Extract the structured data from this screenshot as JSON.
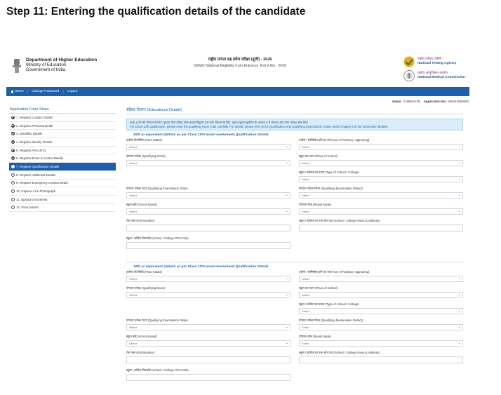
{
  "step_heading": "Step 11: Entering the qualification details of the candidate",
  "header": {
    "dept_line1": "Department of Higher Education",
    "dept_line2": "Ministry of Education",
    "dept_line3": "Government of India",
    "exam_title_hi": "राष्ट्रीय पात्रता सह प्रवेश परीक्षा (यूजी) - 2026",
    "exam_title_en": "DEMO National Eligibility Cum Entrance Test (UG) - 2026",
    "nta_hi": "राष्ट्रीय परीक्षा एजेंसी",
    "nta_en": "National Testing Agency",
    "nmc_hi": "राष्ट्रीय आयुर्विज्ञान आयोग",
    "nmc_en": "National Medical Commission"
  },
  "nav": {
    "home": "Home",
    "change_password": "Change Password",
    "logout": "Logout"
  },
  "info": {
    "name_label": "Name:",
    "name_value": "CANDIDATE",
    "app_label": "Application No.:",
    "app_value": "260410000060"
  },
  "sidebar": {
    "title": "Application Form Steps",
    "items": [
      {
        "label": "1. Register Contact Details",
        "state": "done"
      },
      {
        "label": "2. Register Personal Detail",
        "state": "done"
      },
      {
        "label": "3. Disability Details",
        "state": "done"
      },
      {
        "label": "4. Register Identity Details",
        "state": "done"
      },
      {
        "label": "5. Register APAAR ID",
        "state": "done"
      },
      {
        "label": "6. Register Exam & Center Details",
        "state": "done"
      },
      {
        "label": "7. Register Qualification Details",
        "state": "active"
      },
      {
        "label": "8. Register Additional Details",
        "state": "open"
      },
      {
        "label": "9. Register Emergency Contact Detail",
        "state": "open"
      },
      {
        "label": "10. Capture Live Photograph",
        "state": "open"
      },
      {
        "label": "11. Upload Documents",
        "state": "open"
      },
      {
        "label": "12. Final Submit",
        "state": "open"
      }
    ]
  },
  "main": {
    "title": "शैक्षिक विवरण (Educational Details)",
    "notice_line1": "कक्षा 12वीं की योग्यता के लिए, कृपया योग्य परीक्षा कोड सावधानीपूर्वक दर्ज करें। विवरण के लिए, कृपया सूचना बुलेटिन के अध्याय 6 में योग्यता और योग्य परीक्षा कोड देखें।",
    "notice_line2": "For Class 12th qualification, please enter the qualifying exam code carefully. For details, please refer to the Qualification and Qualifying Examination Codes under Chapter 6 of the Information Bulletin.",
    "select_placeholder": "Select",
    "sections": [
      {
        "heading": "10th or equivalent (details as per Class 10th board marksheet) Qualification Details",
        "pass_status": "उत्तीर्ण की स्थिति (Pass Status)",
        "year_passing": "उत्तीर्ण / सम्मिलित होने का वर्ष (Year of Passing / Appearing)",
        "qualifying_exam": "योग्यता परीक्षा (Qualifying Exam)",
        "place_school": "स्कूल का स्थान (Place of School)",
        "type_school": "स्कूल / कॉलेज का प्रकार (Type of School / College)",
        "qual_state": "योग्यता परीक्षा राज्य (Qualifying Examination State)",
        "qual_district": "योग्यता परीक्षा जिला (Qualifying Examination District)",
        "school_board": "स्कूल बोर्ड (School Board)",
        "result_mode": "परिणाम मोड (Result Mode)",
        "roll_number": "रोल नंबर (Roll Number)",
        "school_name": "स्कूल / कॉलेज का नाम और पता (School / College Name & Address)",
        "pin_code": "स्कूल / कॉलेज पिनकोड (School / College PIN Code)"
      },
      {
        "heading": "12th or equivalent (details as per Class 12th board marksheet) Qualification Details",
        "pass_status": "उत्तीर्ण की स्थिति (Pass Status)",
        "year_passing": "उत्तीर्ण / सम्मिलित होने का वर्ष (Year of Passing / Appearing)",
        "qualifying_exam": "योग्यता परीक्षा (Qualifying Exam)",
        "place_school": "स्कूल का स्थान (Place of School)",
        "type_school": "स्कूल / कॉलेज का प्रकार (Type of School / College)",
        "qual_state": "योग्यता परीक्षा राज्य (Qualifying Examination State)",
        "qual_district": "योग्यता परीक्षा जिला (Qualifying Examination District)",
        "school_board": "स्कूल बोर्ड (School Board)",
        "result_mode": "परिणाम मोड (Result Mode)",
        "roll_number": "रोल नंबर (Roll Number)",
        "school_name": "स्कूल / कॉलेज का नाम और पता (School / College Name & Address)",
        "pin_code": "स्कूल / कॉलेज पिनकोड (School / College PIN Code)"
      }
    ]
  },
  "colors": {
    "primary_blue": "#1f5fa8",
    "notice_bg": "#d9ecf7"
  }
}
